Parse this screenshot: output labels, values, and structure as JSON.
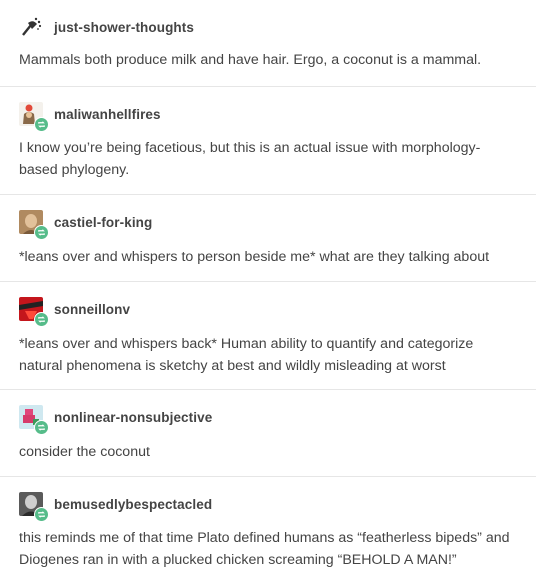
{
  "posts": [
    {
      "username": "just-shower-thoughts",
      "text": "Mammals both produce milk and have hair. Ergo, a coconut is a mammal.",
      "avatar_icon": "shower-head-icon",
      "reblog": false
    },
    {
      "username": "maliwanhellfires",
      "text": "I know you’re being facetious, but this is an actual issue with morphology-based phylogeny.",
      "avatar_icon": "character-avatar",
      "reblog": true
    },
    {
      "username": "castiel-for-king",
      "text": "*leans over and whispers to person beside me* what are they talking about",
      "avatar_icon": "portrait-avatar",
      "reblog": true
    },
    {
      "username": "sonneillonv",
      "text": "*leans over and whispers back*  Human ability to quantify and categorize natural phenomena is sketchy at best and wildly misleading at worst",
      "avatar_icon": "red-art-avatar",
      "reblog": true
    },
    {
      "username": "nonlinear-nonsubjective",
      "text": "consider the coconut",
      "avatar_icon": "pixel-art-avatar",
      "reblog": true
    },
    {
      "username": "bemusedlybespectacled",
      "text": "this reminds me of that time Plato defined humans as “featherless bipeds” and Diogenes ran in with a plucked chicken screaming “BEHOLD A MAN!”",
      "avatar_icon": "dark-portrait-avatar",
      "reblog": true
    }
  ],
  "colors": {
    "text": "#444444",
    "divider": "#e6e6e6",
    "reblog_badge": "#56bc8a"
  }
}
